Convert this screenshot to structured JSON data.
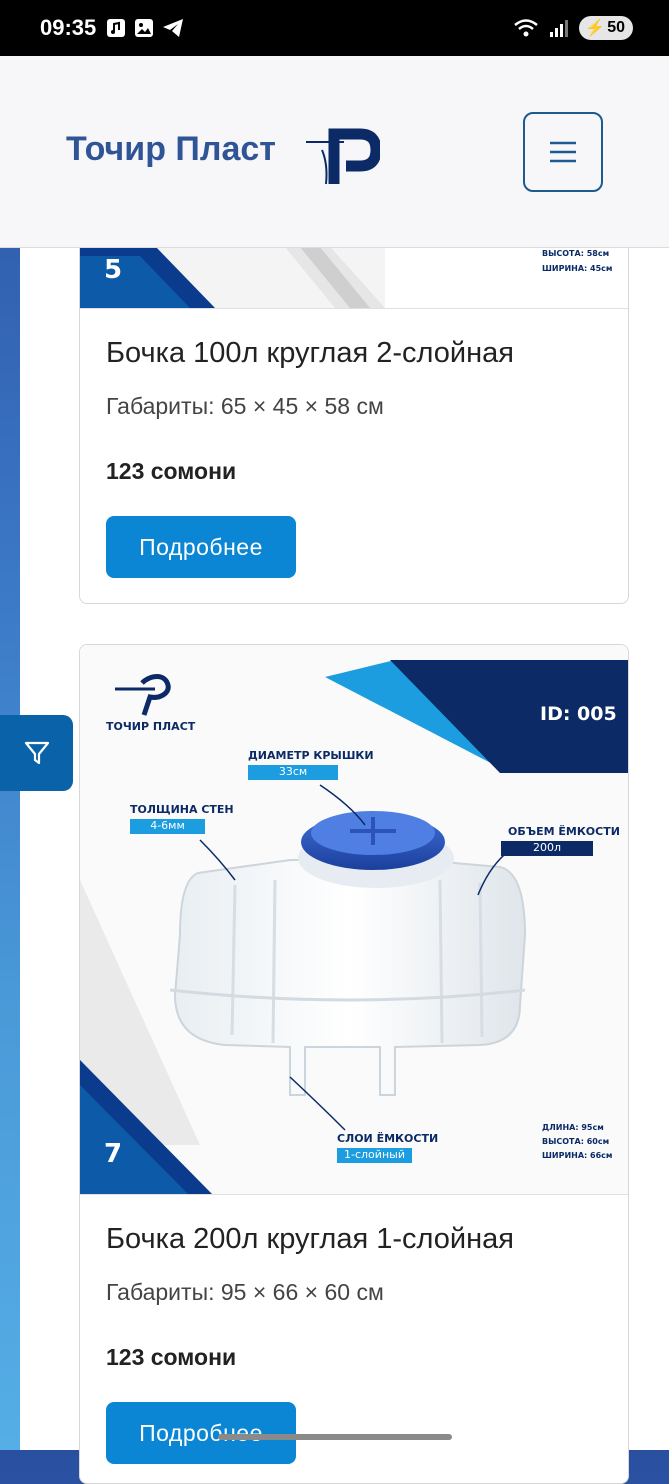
{
  "status_bar": {
    "time": "09:35",
    "battery": "50",
    "icons": [
      "music-note-icon",
      "image-icon",
      "telegram-icon",
      "wifi-icon",
      "signal-icon"
    ]
  },
  "header": {
    "brand": "Точир Пласт",
    "logo_icon": "tochir-plast-logo",
    "menu_icon": "hamburger-icon"
  },
  "products": [
    {
      "image_number": "5",
      "image_specs": [
        "ВЫСОТА: 58см",
        "ШИРИНА: 45см"
      ],
      "title": "Бочка 100л круглая 2-слойная",
      "dims": "Габариты: 65 × 45 × 58 см",
      "price": "123 сомони",
      "button": "Подробнее"
    },
    {
      "image_number": "7",
      "image_brand": "ТОЧИР ПЛАСТ",
      "image_id": "ID: 005",
      "lid_label": "ДИАМЕТР КРЫШКИ",
      "lid_value": "33см",
      "wall_label": "ТОЛЩИНА СТЕН",
      "wall_value": "4-6мм",
      "volume_label": "ОБЪЕМ ЁМКОСТИ",
      "volume_value": "200л",
      "layers_label": "СЛОИ ЁМКОСТИ",
      "layers_value": "1-слойный",
      "image_specs": [
        "ДЛИНА: 95см",
        "ВЫСОТА: 60см",
        "ШИРИНА: 66см"
      ],
      "title": "Бочка 200л круглая 1-слойная",
      "dims": "Габариты: 95 × 66 × 60 см",
      "price": "123 сомони",
      "button": "Подробнее"
    }
  ],
  "filter": {
    "icon": "filter-icon"
  },
  "colors": {
    "brand": "#2f5597",
    "button": "#0a86d4",
    "navy": "#0b2a66",
    "accent": "#1c9de0"
  }
}
